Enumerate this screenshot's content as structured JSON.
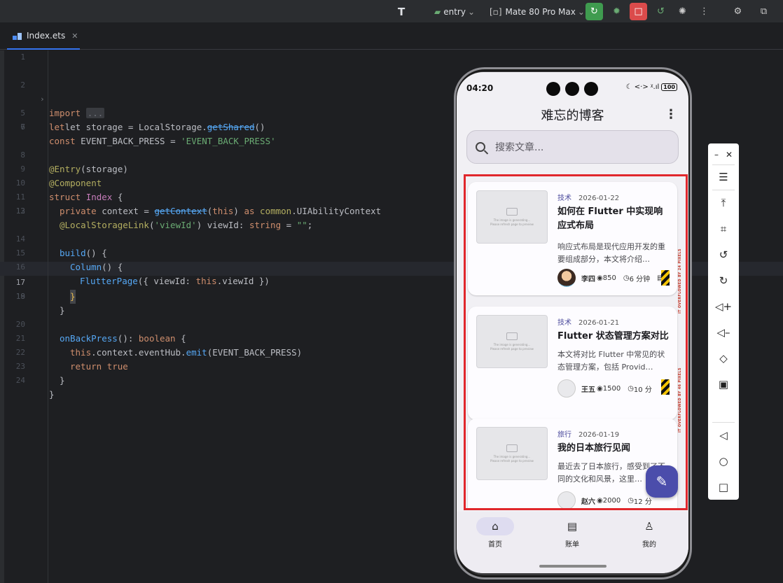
{
  "toolbar": {
    "run_config": "entry",
    "device": "Mate 80 Pro Max",
    "colors": {
      "run_green": "#3f9b4f",
      "stop_red": "#db4b4b"
    }
  },
  "editor": {
    "tab_name": "Index.ets",
    "current_line": "17",
    "lines": [
      {
        "n": "1"
      },
      {
        "n": "2"
      },
      {
        "n": "5"
      },
      {
        "n": "6"
      },
      {
        "n": "7"
      },
      {
        "n": "8"
      },
      {
        "n": "9"
      },
      {
        "n": "10"
      },
      {
        "n": "11"
      },
      {
        "n": "12"
      },
      {
        "n": "13"
      },
      {
        "n": "14"
      },
      {
        "n": "15"
      },
      {
        "n": "16"
      },
      {
        "n": "17"
      },
      {
        "n": "18"
      },
      {
        "n": "19"
      },
      {
        "n": "20"
      },
      {
        "n": "21"
      },
      {
        "n": "22"
      },
      {
        "n": "23"
      },
      {
        "n": "24"
      }
    ],
    "code": {
      "l2": [
        "import",
        "..."
      ],
      "l5": [
        "let storage = LocalStorage.",
        "getShared",
        "()"
      ],
      "l6": [
        "const",
        " EVENT_BACK_PRESS = ",
        "'EVENT_BACK_PRESS'"
      ],
      "l8": [
        "@Entry",
        "(storage)"
      ],
      "l9": [
        "@Component"
      ],
      "l10": [
        "struct",
        " ",
        "Index",
        " {"
      ],
      "l11": [
        "private",
        " context = ",
        "getContext",
        "(",
        "this",
        ") ",
        "as",
        " ",
        "common",
        ".",
        "UIAbilityContext"
      ],
      "l12": [
        "@LocalStorageLink",
        "(",
        "'viewId'",
        ") viewId: ",
        "string",
        " = ",
        "\"\"",
        ";"
      ],
      "l14": [
        "build",
        "() {"
      ],
      "l15": [
        "Column",
        "() {"
      ],
      "l16": [
        "FlutterPage",
        "({ viewId: ",
        "this",
        ".viewId })"
      ],
      "l17": [
        "}"
      ],
      "l18": [
        "}"
      ],
      "l20": [
        "onBackPress",
        "(): ",
        "boolean",
        " {"
      ],
      "l21": [
        "this",
        ".context.eventHub.",
        "emit",
        "(EVENT_BACK_PRESS)"
      ],
      "l22": [
        "return",
        " ",
        "true"
      ],
      "l23": [
        "}"
      ],
      "l24": [
        "}"
      ]
    }
  },
  "phone": {
    "status": {
      "time": "04:20",
      "battery": "100",
      "icons": "☾ <·> ᵡ.ıl"
    },
    "app_title": "难忘的博客",
    "search_placeholder": "搜索文章...",
    "thumb_text_1": "The image is generating...",
    "thumb_text_2": "Please refresh page to preview",
    "overflow_text": "IT OVERFLOWED BY 24 PIXELS",
    "overflow_text_2": "IT OVERFLOWED BY 46 PIXELS",
    "articles": [
      {
        "tag": "技术",
        "date": "2026-01-22",
        "title": "如何在 Flutter 中实现响应式布局",
        "summary": "响应式布局是现代应用开发的重要组成部分，本文将介绍…",
        "author": "李四",
        "views": "850",
        "read_time": "6 分钟",
        "comments": "8"
      },
      {
        "tag": "技术",
        "date": "2026-01-21",
        "title": "Flutter 状态管理方案对比",
        "summary": "本文将对比 Flutter 中常见的状态管理方案，包括 Provid…",
        "author": "王五",
        "views": "1500",
        "read_time": "10 分"
      },
      {
        "tag": "旅行",
        "date": "2026-01-19",
        "title": "我的日本旅行见闻",
        "summary": "最近去了日本旅行，感受到了不同的文化和风景，这里…",
        "author": "赵六",
        "views": "2000",
        "read_time": "12 分"
      }
    ],
    "nav": [
      {
        "label": "首页",
        "icon": "home-icon"
      },
      {
        "label": "账单",
        "icon": "receipt-icon"
      },
      {
        "label": "我的",
        "icon": "person-icon"
      }
    ],
    "colors": {
      "primary": "#4b4dab",
      "highlight_frame": "#e0272c",
      "tag": "#4b4a9c"
    }
  }
}
